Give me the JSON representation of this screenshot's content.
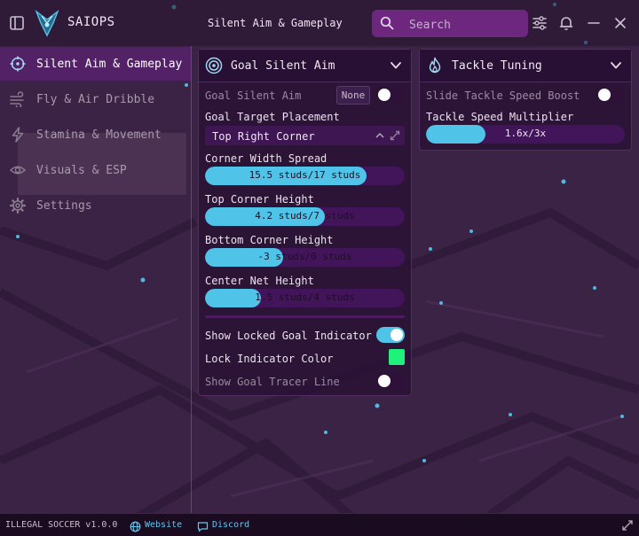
{
  "app": {
    "title": "SAIOPS",
    "page_title": "Silent Aim & Gameplay"
  },
  "search": {
    "placeholder": "Search"
  },
  "sidebar": {
    "items": [
      {
        "label": "Silent Aim & Gameplay",
        "icon": "crosshair-icon",
        "active": true
      },
      {
        "label": "Fly & Air Dribble",
        "icon": "wind-icon",
        "active": false
      },
      {
        "label": "Stamina & Movement",
        "icon": "lightning-icon",
        "active": false
      },
      {
        "label": "Visuals & ESP",
        "icon": "eye-icon",
        "active": false
      },
      {
        "label": "Settings",
        "icon": "gear-icon",
        "active": false
      }
    ]
  },
  "goal_panel": {
    "title": "Goal Silent Aim",
    "enable_label": "Goal Silent Aim",
    "enable_keybind": "None",
    "enable_on": false,
    "placement_label": "Goal Target Placement",
    "placement_value": "Top Right Corner",
    "sliders": [
      {
        "label": "Corner Width Spread",
        "value_text": "15.5 studs/17 studs",
        "fraction": 0.81
      },
      {
        "label": "Top Corner Height",
        "value_text": "4.2 studs/7 studs",
        "fraction": 0.6
      },
      {
        "label": "Bottom Corner Height",
        "value_text": "-3 studs/0 studs",
        "fraction": 0.39
      },
      {
        "label": "Center Net Height",
        "value_text": "1.5 studs/4 studs",
        "fraction": 0.28
      }
    ],
    "locked_indicator_label": "Show Locked Goal Indicator",
    "locked_indicator_on": true,
    "lock_color_label": "Lock Indicator Color",
    "lock_color": "#1ff27a",
    "tracer_label": "Show Goal Tracer Line",
    "tracer_on": false
  },
  "tackle_panel": {
    "title": "Tackle Tuning",
    "boost_label": "Slide Tackle Speed Boost",
    "boost_on": false,
    "multiplier_label": "Tackle Speed Multiplier",
    "multiplier_text": "1.6x/3x",
    "multiplier_fraction": 0.3
  },
  "footer": {
    "version": "ILLEGAL SOCCER v1.0.0",
    "website": "Website",
    "discord": "Discord"
  },
  "colors": {
    "accent": "#4fc3e8",
    "active_nav": "#58226c",
    "search_bg": "#842c96"
  }
}
